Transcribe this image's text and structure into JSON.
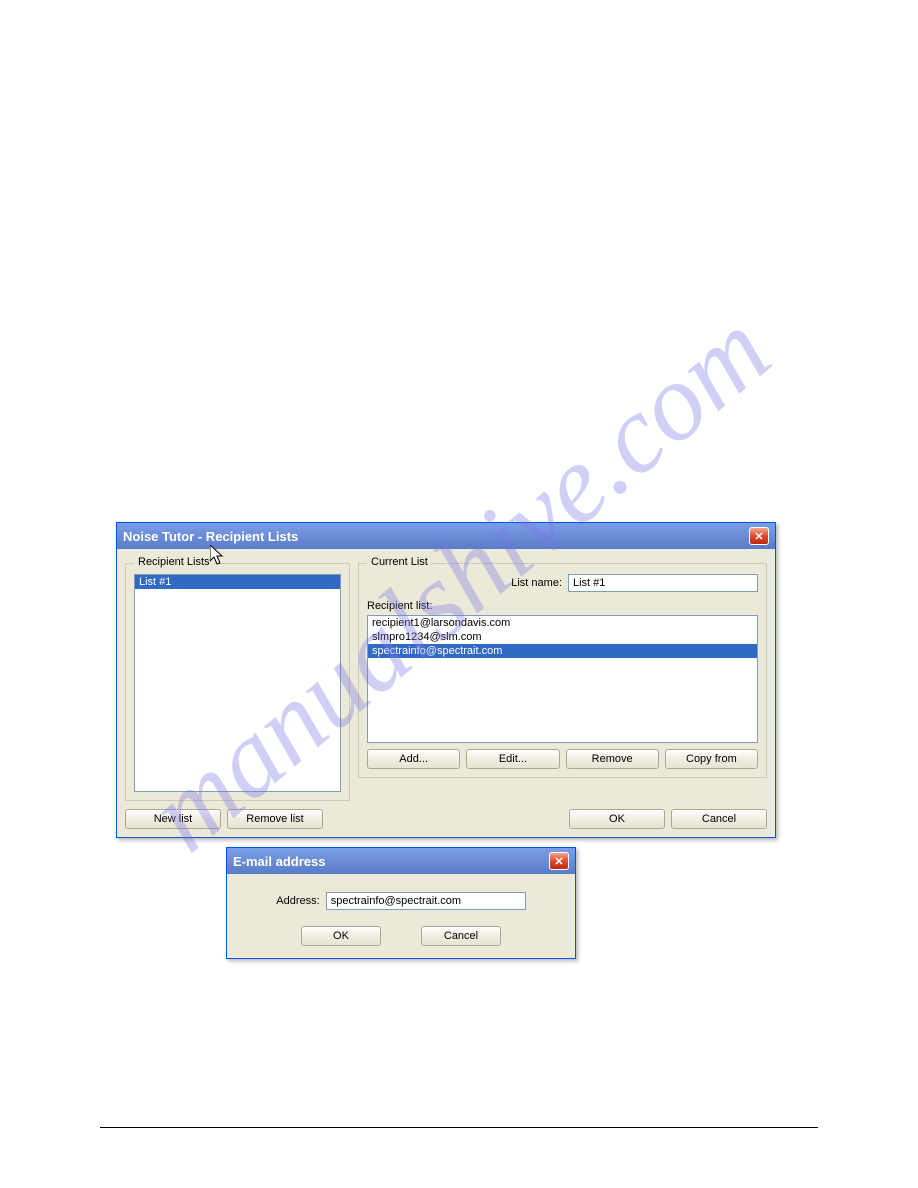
{
  "watermark": "manualshive.com",
  "main_dialog": {
    "title": "Noise Tutor - Recipient Lists",
    "recipient_lists_label": "Recipient Lists",
    "lists": [
      "List #1"
    ],
    "selected_list_index": 0,
    "current_list_label": "Current List",
    "list_name_label": "List name:",
    "list_name_value": "List #1",
    "recipient_list_label": "Recipient list:",
    "recipients": [
      "recipient1@larsondavis.com",
      "slmpro1234@slm.com",
      "spectrainfo@spectrait.com"
    ],
    "selected_recipient_index": 2,
    "buttons": {
      "add": "Add...",
      "edit": "Edit...",
      "remove": "Remove",
      "copy_from": "Copy from",
      "new_list": "New list",
      "remove_list": "Remove list",
      "ok": "OK",
      "cancel": "Cancel"
    }
  },
  "email_dialog": {
    "title": "E-mail address",
    "address_label": "Address:",
    "address_value": "spectrainfo@spectrait.com",
    "buttons": {
      "ok": "OK",
      "cancel": "Cancel"
    }
  }
}
